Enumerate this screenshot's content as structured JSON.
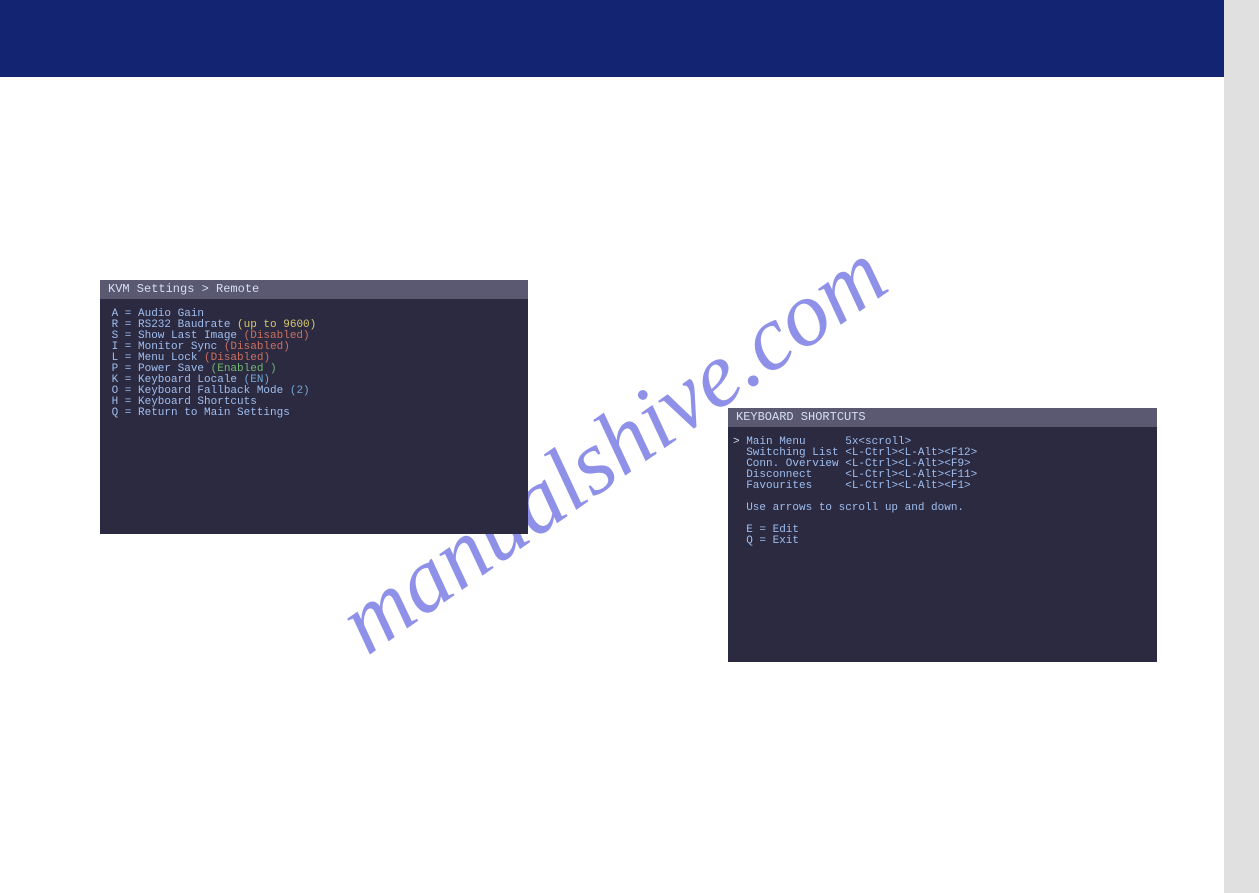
{
  "watermark": "manualshive.com",
  "terminal1": {
    "title": "KVM Settings > Remote",
    "lines": [
      {
        "key": "A",
        "label": "Audio Gain",
        "value": "",
        "cls": ""
      },
      {
        "key": "R",
        "label": "RS232 Baudrate",
        "value": "(up to 9600)",
        "cls": "val-yellow"
      },
      {
        "key": "S",
        "label": "Show Last Image",
        "value": "(Disabled)",
        "cls": "val-red"
      },
      {
        "key": "I",
        "label": "Monitor Sync",
        "value": "(Disabled)",
        "cls": "val-red"
      },
      {
        "key": "L",
        "label": "Menu Lock",
        "value": "(Disabled)",
        "cls": "val-red"
      },
      {
        "key": "P",
        "label": "Power Save",
        "value": "(Enabled )",
        "cls": "val-green"
      },
      {
        "key": "K",
        "label": "Keyboard Locale",
        "value": "(EN)",
        "cls": "val-blue"
      },
      {
        "key": "O",
        "label": "Keyboard Fallback Mode",
        "value": "(2)",
        "cls": "val-blue"
      },
      {
        "key": "H",
        "label": "Keyboard Shortcuts",
        "value": "",
        "cls": ""
      },
      {
        "key": "Q",
        "label": "Return to Main Settings",
        "value": "",
        "cls": ""
      }
    ]
  },
  "terminal2": {
    "title": "KEYBOARD SHORTCUTS",
    "rows": [
      {
        "cursor": ">",
        "name": "Main Menu",
        "binding": "5x<scroll>"
      },
      {
        "cursor": " ",
        "name": "Switching List",
        "binding": "<L-Ctrl><L-Alt><F12>"
      },
      {
        "cursor": " ",
        "name": "Conn. Overview",
        "binding": "<L-Ctrl><L-Alt><F9>"
      },
      {
        "cursor": " ",
        "name": "Disconnect",
        "binding": "<L-Ctrl><L-Alt><F11>"
      },
      {
        "cursor": " ",
        "name": "Favourites",
        "binding": "<L-Ctrl><L-Alt><F1>"
      }
    ],
    "hint": "Use arrows to scroll up and down.",
    "footer": [
      {
        "key": "E",
        "label": "Edit"
      },
      {
        "key": "Q",
        "label": "Exit"
      }
    ]
  }
}
